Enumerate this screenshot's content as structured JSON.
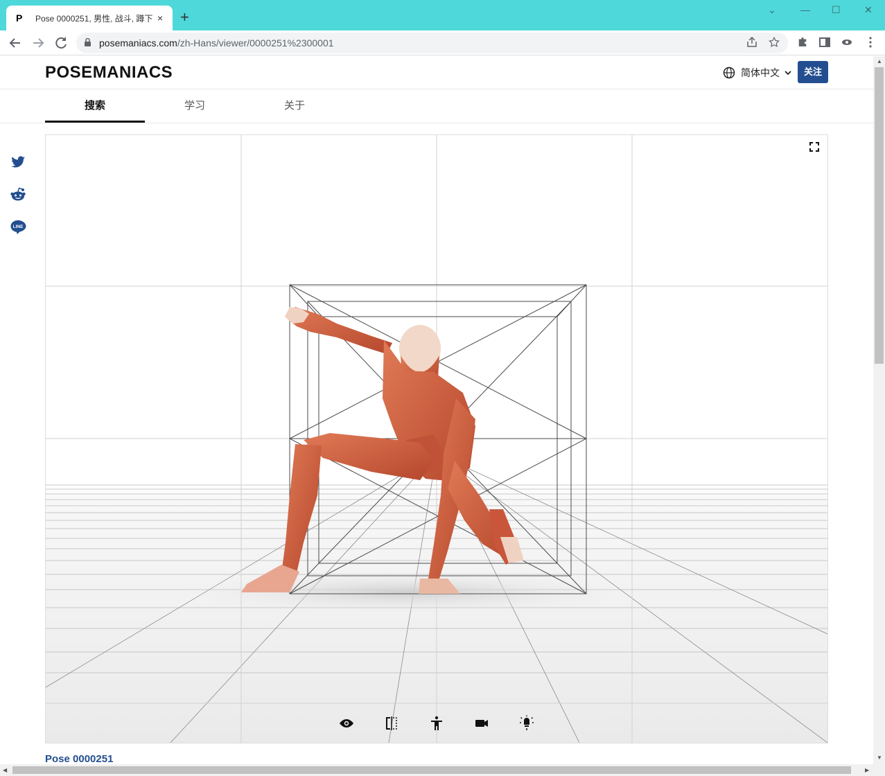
{
  "browser": {
    "tab_title": "Pose 0000251, 男性, 战斗, 蹲下",
    "tab_favicon": "P",
    "tab_close": "×",
    "new_tab": "+",
    "url_host": "posemaniacs.com",
    "url_path": "/zh-Hans/viewer/0000251%2300001",
    "controls": {
      "minimize": "—",
      "maximize": "☐",
      "close": "✕",
      "collapse": "⌄"
    }
  },
  "header": {
    "logo": "POSEMANIACS",
    "language": "简体中文",
    "follow_button": "关注"
  },
  "nav": {
    "tabs": [
      {
        "label": "搜索",
        "active": true
      },
      {
        "label": "学习",
        "active": false
      },
      {
        "label": "关于",
        "active": false
      }
    ]
  },
  "social": {
    "icons": [
      "twitter-icon",
      "reddit-icon",
      "line-icon"
    ],
    "line_text": "LINE",
    "color": "#234e8f"
  },
  "viewer": {
    "controls": [
      "eye-icon",
      "mirror-icon",
      "pose-icon",
      "camera-icon",
      "light-icon"
    ]
  },
  "pose": {
    "title": "Pose 0000251"
  },
  "colors": {
    "titlebar": "#4ed8da",
    "accent": "#234e8f",
    "muscle": "#c9563a"
  }
}
